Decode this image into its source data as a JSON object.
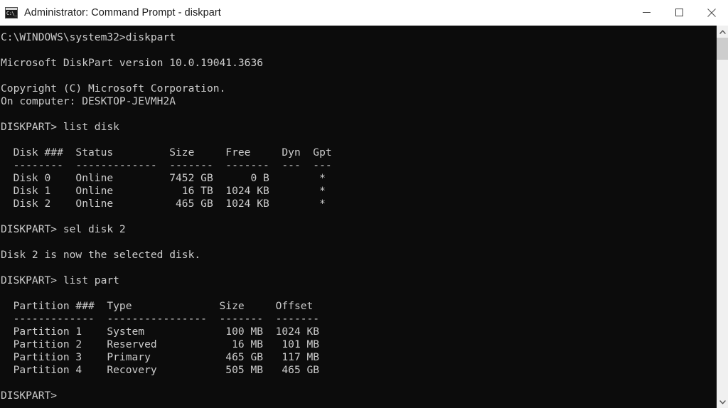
{
  "window": {
    "title": "Administrator: Command Prompt - diskpart",
    "app_icon": "command-prompt-icon",
    "icon_glyph": "C:\\_",
    "background_color": "#0c0c0c",
    "foreground_color": "#cccccc",
    "titlebar_color": "#ffffff",
    "titlebar_text_color": "#1b1b1b"
  },
  "window_controls": {
    "minimize_label": "Minimize",
    "maximize_label": "Maximize",
    "close_label": "Close",
    "close_hover_color": "#e81123"
  },
  "scrollbar": {
    "up_arrow_label": "Scroll up",
    "down_arrow_label": "Scroll down",
    "thumb_label": "Scroll thumb",
    "track_color": "#f0f0f0",
    "thumb_color": "#cdcdcd"
  },
  "terminal": {
    "prompt_cwd": "C:\\WINDOWS\\system32>",
    "lines": [
      "C:\\WINDOWS\\system32>diskpart",
      "",
      "Microsoft DiskPart version 10.0.19041.3636",
      "",
      "Copyright (C) Microsoft Corporation.",
      "On computer: DESKTOP-JEVMH2A",
      "",
      "DISKPART> list disk",
      "",
      "  Disk ###  Status         Size     Free     Dyn  Gpt",
      "  --------  -------------  -------  -------  ---  ---",
      "  Disk 0    Online         7452 GB      0 B        *",
      "  Disk 1    Online           16 TB  1024 KB        *",
      "  Disk 2    Online          465 GB  1024 KB        *",
      "",
      "DISKPART> sel disk 2",
      "",
      "Disk 2 is now the selected disk.",
      "",
      "DISKPART> list part",
      "",
      "  Partition ###  Type              Size     Offset",
      "  -------------  ----------------  -------  -------",
      "  Partition 1    System             100 MB  1024 KB",
      "  Partition 2    Reserved            16 MB   101 MB",
      "  Partition 3    Primary            465 GB   117 MB",
      "  Partition 4    Recovery           505 MB   465 GB",
      "",
      "DISKPART>"
    ],
    "commands_entered": [
      "diskpart",
      "list disk",
      "sel disk 2",
      "list part"
    ],
    "diskpart_version": "10.0.19041.3636",
    "computer_name": "DESKTOP-JEVMH2A",
    "copyright": "Copyright (C) Microsoft Corporation.",
    "selected_disk_message": "Disk 2 is now the selected disk.",
    "disk_table": {
      "headers": [
        "Disk ###",
        "Status",
        "Size",
        "Free",
        "Dyn",
        "Gpt"
      ],
      "rows": [
        {
          "disk": "Disk 0",
          "status": "Online",
          "size": "7452 GB",
          "free": "0 B",
          "dyn": "",
          "gpt": "*"
        },
        {
          "disk": "Disk 1",
          "status": "Online",
          "size": "16 TB",
          "free": "1024 KB",
          "dyn": "",
          "gpt": "*"
        },
        {
          "disk": "Disk 2",
          "status": "Online",
          "size": "465 GB",
          "free": "1024 KB",
          "dyn": "",
          "gpt": "*"
        }
      ]
    },
    "partition_table": {
      "headers": [
        "Partition ###",
        "Type",
        "Size",
        "Offset"
      ],
      "rows": [
        {
          "partition": "Partition 1",
          "type": "System",
          "size": "100 MB",
          "offset": "1024 KB"
        },
        {
          "partition": "Partition 2",
          "type": "Reserved",
          "size": "16 MB",
          "offset": "101 MB"
        },
        {
          "partition": "Partition 3",
          "type": "Primary",
          "size": "465 GB",
          "offset": "117 MB"
        },
        {
          "partition": "Partition 4",
          "type": "Recovery",
          "size": "505 MB",
          "offset": "465 GB"
        }
      ]
    }
  }
}
